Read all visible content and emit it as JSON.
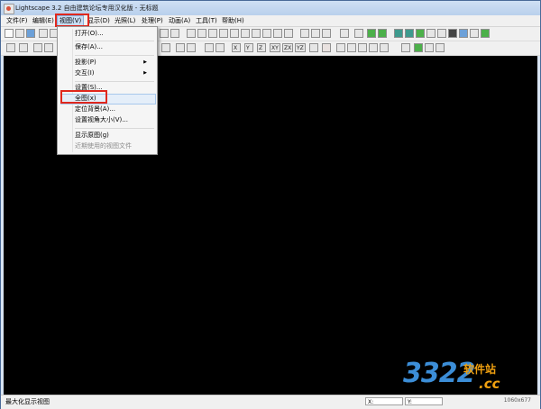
{
  "window": {
    "title": "Lightscape 3.2 自由建筑论坛专用汉化版 - 无标题"
  },
  "menubar": [
    {
      "label": "文件(F)"
    },
    {
      "label": "编辑(E)"
    },
    {
      "label": "视图(V)"
    },
    {
      "label": "显示(D)"
    },
    {
      "label": "光照(L)"
    },
    {
      "label": "处理(P)"
    },
    {
      "label": "动画(A)"
    },
    {
      "label": "工具(T)"
    },
    {
      "label": "帮助(H)"
    }
  ],
  "dropdown": {
    "items": [
      {
        "label": "打开(O)..."
      },
      {
        "label": "保存(A)..."
      },
      {
        "label": "投影(P)"
      },
      {
        "label": "交互(I)"
      },
      {
        "label": "设置(S)..."
      },
      {
        "label": "全图(x)"
      },
      {
        "label": "定位背景(A)..."
      },
      {
        "label": "设置视角大小(V)..."
      },
      {
        "label": "显示原图(g)"
      },
      {
        "label": "近期使用的视图文件"
      }
    ]
  },
  "toolbar2_axes": [
    "X",
    "Y",
    "Z",
    "XY",
    "ZX",
    "YZ"
  ],
  "status": {
    "message": "最大化显示视图",
    "x_label": "X:",
    "y_label": "Y:",
    "dimensions": "1060x677"
  },
  "watermark": {
    "number": "3322",
    "site": "软件站",
    "domain": ".cc"
  },
  "colors": {
    "highlight_red": "#e0281e",
    "viewport": "#000000",
    "menu_active": "#c8ddf4"
  }
}
